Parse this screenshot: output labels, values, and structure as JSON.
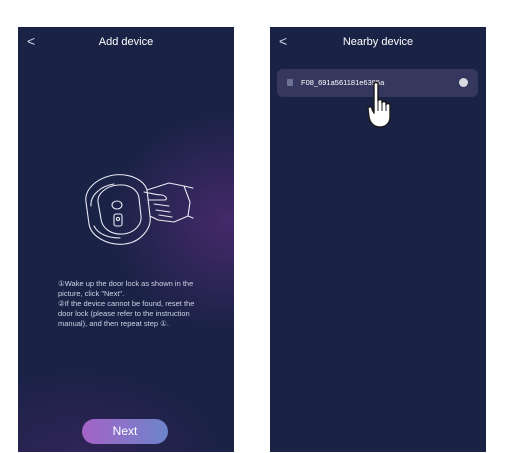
{
  "add_device_screen": {
    "back_icon": "chevron-left-icon",
    "back_glyph": "<",
    "title": "Add device",
    "instructions": [
      "①Wake up the door lock as shown in the picture, click \"Next\".",
      "②If the device cannot be found, reset the door lock (please refer to the instruction manual), and then repeat step ①."
    ],
    "next_label": "Next"
  },
  "nearby_device_screen": {
    "back_icon": "chevron-left-icon",
    "back_glyph": "<",
    "title": "Nearby device",
    "devices": [
      {
        "name": "F08_691a561181e6395a",
        "selected": false
      }
    ]
  },
  "colors": {
    "background": "#1a2246",
    "device_row": "#35375f",
    "button_gradient_start": "#a463c6",
    "button_gradient_end": "#6d84ca"
  }
}
